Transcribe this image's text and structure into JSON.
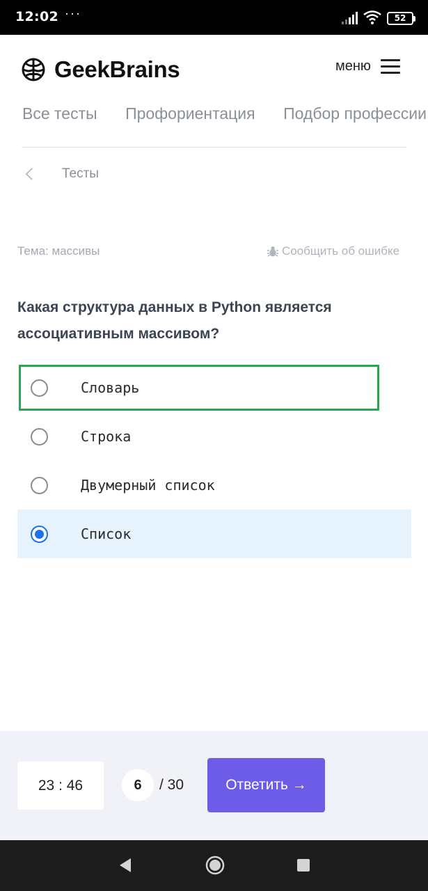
{
  "status_bar": {
    "time": "12:02",
    "notifications": "···",
    "battery": "52"
  },
  "header": {
    "brand": "GeekBrains",
    "menu_label": "меню"
  },
  "tabs": [
    {
      "label": "Все тесты"
    },
    {
      "label": "Профориентация"
    },
    {
      "label": "Подбор профессии"
    }
  ],
  "breadcrumb": {
    "label": "Тесты"
  },
  "quiz": {
    "topic": "Тема: массивы",
    "report_label": "Сообщить об ошибке",
    "question": "Какая структура данных в Python является ассоциативным массивом?",
    "answers": [
      {
        "label": "Словарь",
        "selected": false,
        "highlighted": true
      },
      {
        "label": "Строка",
        "selected": false,
        "highlighted": false
      },
      {
        "label": "Двумерный список",
        "selected": false,
        "highlighted": false
      },
      {
        "label": "Список",
        "selected": true,
        "highlighted": false
      }
    ]
  },
  "footer": {
    "timer": "23 : 46",
    "current_question": "6",
    "total_questions": "/ 30",
    "submit_label": "Ответить →"
  },
  "colors": {
    "accent": "#6c5ce7",
    "selected_bg": "#e6f3fc",
    "radio_checked": "#1a73e8",
    "highlight_border": "#27a84a"
  }
}
